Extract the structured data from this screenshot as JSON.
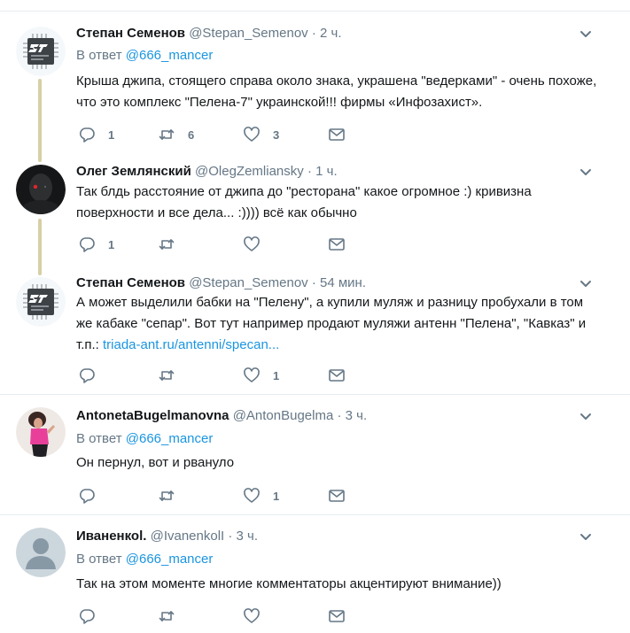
{
  "tweets": [
    {
      "name": "Степан Семенов",
      "handle": "@Stepan_Semenov",
      "dot": "·",
      "time": "2 ч.",
      "reply_prefix": "В ответ",
      "reply_to": "@666_mancer",
      "text": "Крыша джипа, стоящего справа около знака, украшена \"ведерками\" - очень похоже, что это комплекс \"Пелена-7\" украинской!!! фирмы «Инфозахист».",
      "reply_count": "1",
      "retweet_count": "6",
      "like_count": "3",
      "avatar": "chip-avatar"
    },
    {
      "name": "Олег Землянский",
      "handle": "@OlegZemliansky",
      "dot": "·",
      "time": "1 ч.",
      "text": "Так блдь расстояние от джипа до \"ресторана\" какое огромное :) кривизна поверхности и все дела... :)))) всё как обычно",
      "reply_count": "1",
      "retweet_count": "",
      "like_count": "",
      "avatar": "dark-face-avatar"
    },
    {
      "name": "Степан Семенов",
      "handle": "@Stepan_Semenov",
      "dot": "·",
      "time": "54 мин.",
      "text": "А может выделили бабки на \"Пелену\", а купили муляж и разницу пробухали в том же кабаке \"сепар\". Вот тут например продают муляжи антенн \"Пелена\", \"Кавказ\" и т.п.: ",
      "link": "triada-ant.ru/antenni/specan...",
      "reply_count": "",
      "retweet_count": "",
      "like_count": "1",
      "avatar": "chip-avatar"
    },
    {
      "name": "AntonetaBugelmanovna",
      "handle": "@AntonBugelma",
      "dot": "·",
      "time": "3 ч.",
      "reply_prefix": "В ответ",
      "reply_to": "@666_mancer",
      "text": "Он пернул, вот и рвануло",
      "reply_count": "",
      "retweet_count": "",
      "like_count": "1",
      "avatar": "pink-photo-avatar"
    },
    {
      "name": "Иваненкоl.",
      "handle": "@IvanenkolI",
      "dot": "·",
      "time": "3 ч.",
      "reply_prefix": "В ответ",
      "reply_to": "@666_mancer",
      "text": "Так на этом моменте многие комментаторы акцентируют внимание))",
      "reply_count": "",
      "retweet_count": "",
      "like_count": "",
      "avatar": "default-avatar"
    }
  ],
  "icons": {
    "reply": "reply-icon",
    "retweet": "retweet-icon",
    "like": "like-icon",
    "message": "message-icon",
    "more": "chevron-down-icon"
  },
  "colors": {
    "link": "#1b95e0",
    "muted": "#657786",
    "text": "#14171a",
    "divider": "#e6ecf0",
    "thread_line": "#d7cfa6"
  }
}
